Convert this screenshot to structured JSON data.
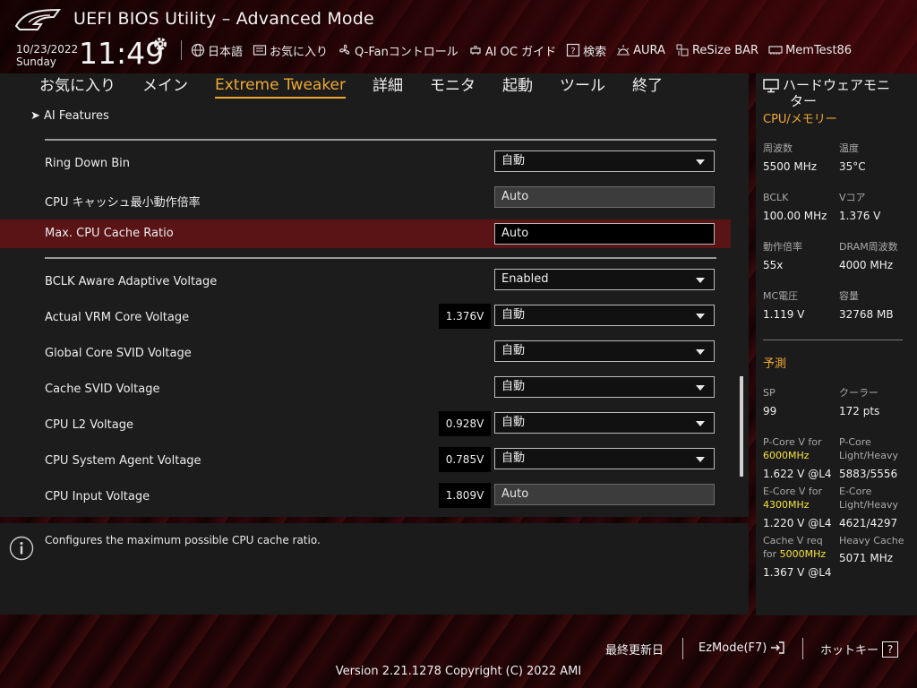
{
  "header": {
    "title": "UEFI BIOS Utility – Advanced Mode",
    "date": "10/23/2022",
    "day": "Sunday",
    "time": "11:49",
    "tools": [
      {
        "icon": "globe-icon",
        "label": "日本語"
      },
      {
        "icon": "favorites-icon",
        "label": "お気に入り"
      },
      {
        "icon": "fan-icon",
        "label": "Q-Fanコントロール"
      },
      {
        "icon": "ai-oc-icon",
        "label": "AI OC ガイド"
      },
      {
        "icon": "search-icon",
        "label": "検索"
      },
      {
        "icon": "aura-icon",
        "label": "AURA"
      },
      {
        "icon": "resize-bar-icon",
        "label": "ReSize BAR"
      },
      {
        "icon": "memtest-icon",
        "label": "MemTest86"
      }
    ]
  },
  "tabs": [
    "お気に入り",
    "メイン",
    "Extreme Tweaker",
    "詳細",
    "モニタ",
    "起動",
    "ツール",
    "終了"
  ],
  "active_tab": "Extreme Tweaker",
  "ai_features": "AI Features",
  "rows": [
    {
      "label": "Ring Down Bin",
      "voltage": null,
      "value": "自動",
      "type": "dropdown"
    },
    {
      "label": "CPU キャッシュ最小動作倍率",
      "voltage": null,
      "value": "Auto",
      "type": "readonly"
    },
    {
      "label": "Max. CPU Cache Ratio",
      "voltage": null,
      "value": "Auto",
      "type": "input"
    },
    {
      "label": "BCLK Aware Adaptive Voltage",
      "voltage": null,
      "value": "Enabled",
      "type": "dropdown"
    },
    {
      "label": "Actual VRM Core Voltage",
      "voltage": "1.376V",
      "value": "自動",
      "type": "dropdown"
    },
    {
      "label": "Global Core SVID Voltage",
      "voltage": null,
      "value": "自動",
      "type": "dropdown"
    },
    {
      "label": "Cache SVID Voltage",
      "voltage": null,
      "value": "自動",
      "type": "dropdown"
    },
    {
      "label": "CPU L2 Voltage",
      "voltage": "0.928V",
      "value": "自動",
      "type": "dropdown"
    },
    {
      "label": "CPU System Agent Voltage",
      "voltage": "0.785V",
      "value": "自動",
      "type": "dropdown"
    },
    {
      "label": "CPU Input Voltage",
      "voltage": "1.809V",
      "value": "Auto",
      "type": "readonly"
    }
  ],
  "help_text": "Configures the maximum possible CPU cache ratio.",
  "monitor": {
    "title_line1": "ハードウェアモニ",
    "title_line2": "ター",
    "cpu_mem_title": "CPU/メモリー",
    "cpu_mem": [
      {
        "label": "周波数",
        "value": "5500 MHz"
      },
      {
        "label": "温度",
        "value": "35°C"
      },
      {
        "label": "BCLK",
        "value": "100.00 MHz"
      },
      {
        "label": "Vコア",
        "value": "1.376 V"
      },
      {
        "label": "動作倍率",
        "value": "55x"
      },
      {
        "label": "DRAM周波数",
        "value": "4000 MHz"
      },
      {
        "label": "MC電圧",
        "value": "1.119 V"
      },
      {
        "label": "容量",
        "value": "32768 MB"
      }
    ],
    "predict_title": "予測",
    "sp_label": "SP",
    "sp_value": "99",
    "cooler_label": "クーラー",
    "cooler_value": "172 pts",
    "pcore_v_label": "P-Core V for",
    "pcore_v_freq": "6000MHz",
    "pcore_v_value": "1.622 V @L4",
    "pcore_lh_label1": "P-Core",
    "pcore_lh_label2": "Light/Heavy",
    "pcore_lh_value": "5883/5556",
    "ecore_v_label": "E-Core V for",
    "ecore_v_freq": "4300MHz",
    "ecore_v_value": "1.220 V @L4",
    "ecore_lh_label1": "E-Core",
    "ecore_lh_label2": "Light/Heavy",
    "ecore_lh_value": "4621/4297",
    "cache_v_label1": "Cache V req",
    "cache_v_label2": "for",
    "cache_v_freq": "5000MHz",
    "cache_v_value": "1.367 V @L4",
    "heavy_cache_label": "Heavy Cache",
    "heavy_cache_value": "5071 MHz"
  },
  "footer": {
    "last_modified": "最終更新日",
    "ezmode": "EzMode(F7)",
    "hotkeys": "ホットキー",
    "hotkey_icon": "?",
    "version": "Version 2.21.1278 Copyright (C) 2022 AMI"
  },
  "colors": {
    "accent": "#f0a832",
    "highlight_row": "#5a1416",
    "freq_yellow": "#f7e23a"
  }
}
